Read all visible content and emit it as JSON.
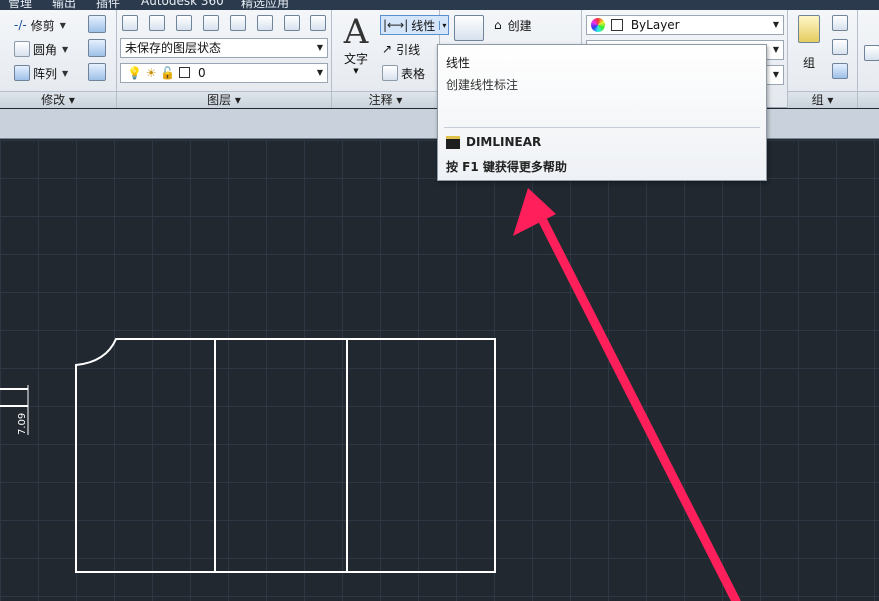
{
  "menu": {
    "tabs": [
      "管理",
      "输出",
      "插件",
      "Autodesk 360",
      "精选应用"
    ]
  },
  "modify_panel": {
    "title": "修改",
    "tools": [
      "修剪",
      "圆角",
      "阵列"
    ]
  },
  "layers_panel": {
    "title": "图层",
    "layer_state": "未保存的图层状态",
    "current_layer": "0"
  },
  "annotation_panel": {
    "title": "注释",
    "text_label": "文字",
    "dim_label": "线性",
    "leader_label": "引线",
    "table_label": "表格"
  },
  "block_panel": {
    "create_label": "创建"
  },
  "properties_panel": {
    "color": "ByLayer"
  },
  "groups_panel": {
    "title": "组",
    "group_label": "组"
  },
  "tooltip": {
    "title": "线性",
    "description": "创建线性标注",
    "command": "DIMLINEAR",
    "help": "按 F1 键获得更多帮助"
  },
  "drawing": {
    "dimension_text": "7.09"
  },
  "colors": {
    "arrow": "#ff1f5a",
    "canvas_bg": "#212830",
    "line": "#ffffff"
  }
}
